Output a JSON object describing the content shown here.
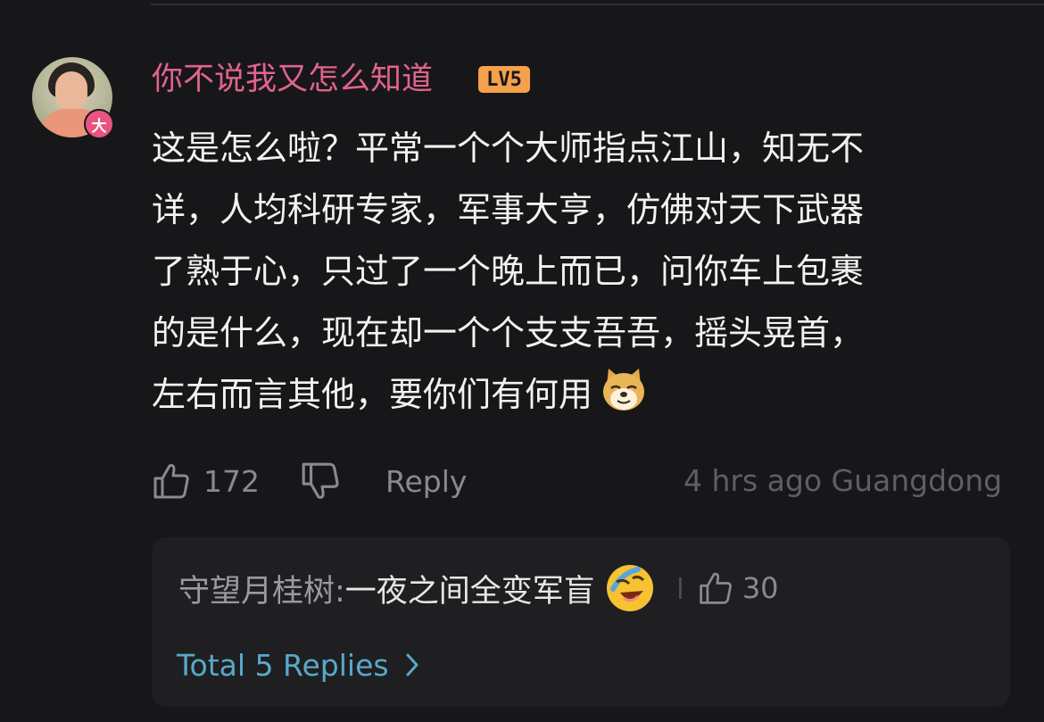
{
  "comment": {
    "username": "你不说我又怎么知道",
    "level": "LV5",
    "avatar_badge": "大",
    "lines": [
      "这是怎么啦？平常一个个大师指点江山，知无不",
      "详，人均科研专家，军事大亨，仿佛对天下武器",
      "了熟于心，只过了一个晚上而已，问你车上包裹",
      "的是什么，现在却一个个支支吾吾，摇头晃首，",
      "左右而言其他，要你们有何用"
    ],
    "trailing_emoji": "doge-emoji",
    "likes": "172",
    "reply_label": "Reply",
    "time_ago": "4 hrs ago",
    "location": "Guangdong"
  },
  "reply_preview": {
    "author": "守望月桂树: ",
    "text": "一夜之间全变军盲",
    "emoji": "laughing-tears-emoji",
    "likes": "30",
    "total_label": "Total 5 Replies"
  },
  "colors": {
    "background": "#17171a",
    "username": "#e0638e",
    "level_badge": "#f5a04b",
    "link": "#58a9c9",
    "muted": "#8a8a8e"
  }
}
